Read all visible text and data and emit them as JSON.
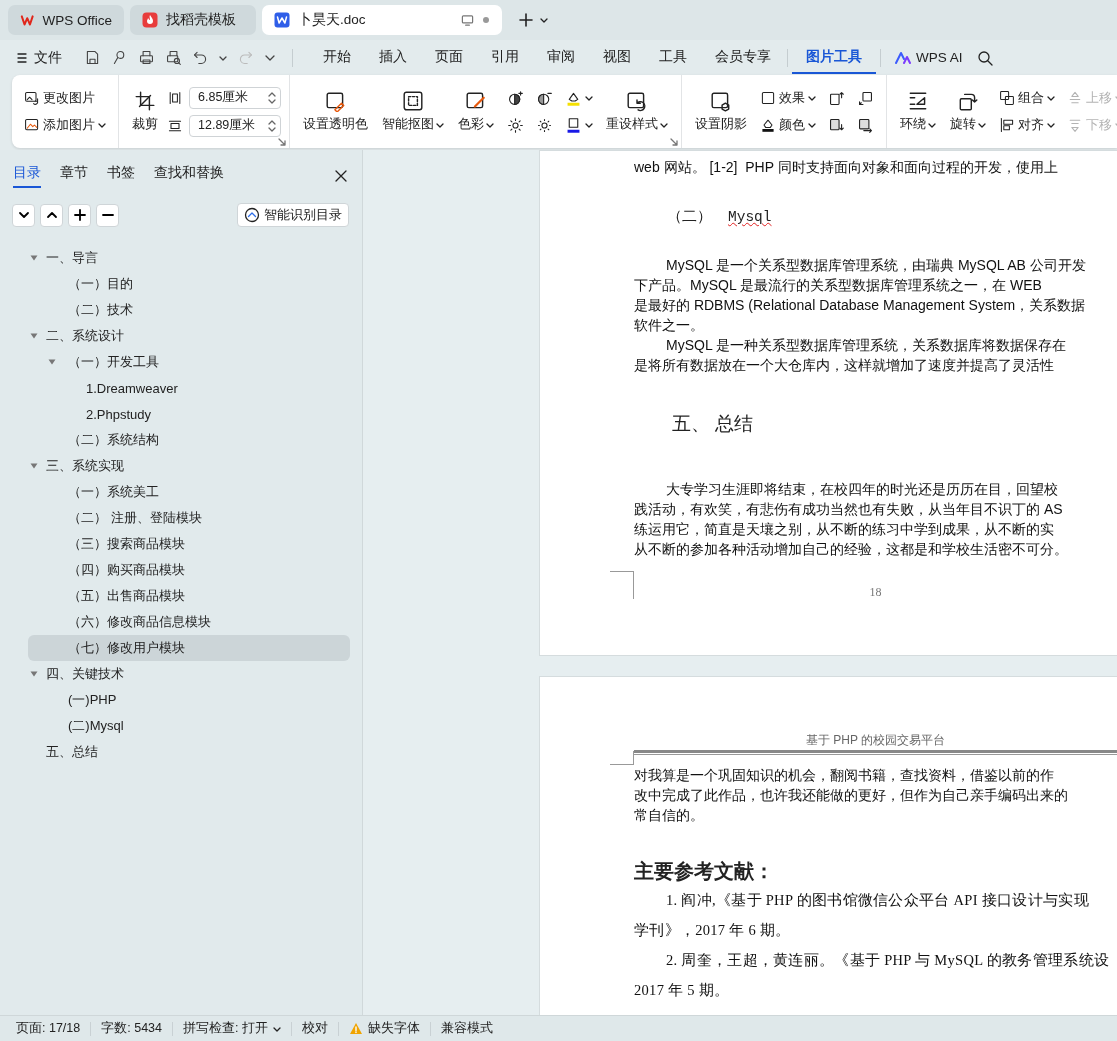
{
  "tabs": [
    {
      "label": "WPS Office",
      "kind": "home",
      "selected": false
    },
    {
      "label": "找稻壳模板",
      "kind": "template",
      "selected": false
    },
    {
      "label": "卜昊天.doc",
      "kind": "document",
      "selected": true
    }
  ],
  "menu": {
    "file": "文件",
    "items": [
      {
        "label": "开始",
        "kind": "tab",
        "selected": false
      },
      {
        "label": "插入",
        "kind": "tab",
        "selected": false
      },
      {
        "label": "页面",
        "kind": "tab",
        "selected": false
      },
      {
        "label": "引用",
        "kind": "tab",
        "selected": false
      },
      {
        "label": "审阅",
        "kind": "tab",
        "selected": false
      },
      {
        "label": "视图",
        "kind": "tab",
        "selected": false
      },
      {
        "label": "工具",
        "kind": "tab",
        "selected": false
      },
      {
        "label": "会员专享",
        "kind": "tab",
        "selected": false
      },
      {
        "label": "图片工具",
        "kind": "context",
        "selected": true
      }
    ],
    "ai": "WPS AI"
  },
  "ribbon": {
    "groups": [
      {
        "launcher": false,
        "columns": [
          [
            {
              "kind": "row",
              "label": "更改图片",
              "dropdown": false,
              "disabled": false
            },
            {
              "kind": "row",
              "label": "添加图片",
              "dropdown": true,
              "disabled": false
            }
          ]
        ]
      },
      {
        "launcher": true,
        "columns": [
          [
            {
              "kind": "big",
              "label": "裁剪",
              "dropdown": false,
              "disabled": false
            }
          ],
          [
            {
              "kind": "field",
              "value": "6.85厘米"
            },
            {
              "kind": "field",
              "value": "12.89厘米"
            }
          ]
        ]
      },
      {
        "launcher": true,
        "columns": [
          [
            {
              "kind": "big",
              "label": "设置透明色",
              "dropdown": false,
              "disabled": false
            }
          ],
          [
            {
              "kind": "big",
              "label": "智能抠图",
              "dropdown": true,
              "disabled": false
            }
          ],
          [
            {
              "kind": "big",
              "label": "色彩",
              "dropdown": true,
              "disabled": false
            }
          ],
          [
            {
              "kind": "icon",
              "dropdown": false,
              "disabled": false
            },
            {
              "kind": "icon",
              "dropdown": false,
              "disabled": false
            }
          ],
          [
            {
              "kind": "icon",
              "dropdown": false,
              "disabled": false
            },
            {
              "kind": "icon",
              "dropdown": false,
              "disabled": false
            }
          ],
          [
            {
              "kind": "icon",
              "dropdown": true,
              "disabled": false
            },
            {
              "kind": "icon",
              "dropdown": true,
              "disabled": false
            }
          ],
          [
            {
              "kind": "big",
              "label": "重设样式",
              "dropdown": true,
              "disabled": false
            }
          ]
        ]
      },
      {
        "launcher": false,
        "columns": [
          [
            {
              "kind": "big",
              "label": "设置阴影",
              "dropdown": false,
              "disabled": false
            }
          ],
          [
            {
              "kind": "row",
              "label": "效果",
              "dropdown": true,
              "disabled": false
            },
            {
              "kind": "row",
              "label": "颜色",
              "dropdown": true,
              "disabled": false
            }
          ],
          [
            {
              "kind": "icon",
              "dropdown": false,
              "disabled": false
            },
            {
              "kind": "icon",
              "dropdown": false,
              "disabled": false
            }
          ],
          [
            {
              "kind": "icon",
              "dropdown": false,
              "disabled": false
            },
            {
              "kind": "icon",
              "dropdown": false,
              "disabled": false
            }
          ]
        ]
      },
      {
        "launcher": false,
        "columns": [
          [
            {
              "kind": "big",
              "label": "环绕",
              "dropdown": true,
              "disabled": false
            }
          ],
          [
            {
              "kind": "big",
              "label": "旋转",
              "dropdown": true,
              "disabled": false
            }
          ],
          [
            {
              "kind": "row",
              "label": "组合",
              "dropdown": true,
              "disabled": false
            },
            {
              "kind": "row",
              "label": "对齐",
              "dropdown": true,
              "disabled": false
            }
          ],
          [
            {
              "kind": "row",
              "label": "上移",
              "dropdown": true,
              "disabled": true
            },
            {
              "kind": "row",
              "label": "下移",
              "dropdown": true,
              "disabled": true
            }
          ]
        ]
      }
    ]
  },
  "nav": {
    "tabs": [
      {
        "label": "目录",
        "selected": true
      },
      {
        "label": "章节",
        "selected": false
      },
      {
        "label": "书签",
        "selected": false
      },
      {
        "label": "查找和替换",
        "selected": false
      }
    ],
    "smart_button": "智能识别目录",
    "tree": [
      {
        "label": "一、导言",
        "expanded": true,
        "selected": false,
        "children": [
          {
            "label": "（一）目的",
            "selected": false
          },
          {
            "label": "（二）技术",
            "selected": false
          }
        ]
      },
      {
        "label": "二、系统设计",
        "expanded": true,
        "selected": false,
        "children": [
          {
            "label": "（一）开发工具",
            "expanded": true,
            "selected": false,
            "children": [
              {
                "label": "1.Dreamweaver",
                "selected": false
              },
              {
                "label": "2.Phpstudy",
                "selected": false
              }
            ]
          },
          {
            "label": "（二）系统结构",
            "selected": false
          }
        ]
      },
      {
        "label": "三、系统实现",
        "expanded": true,
        "selected": false,
        "children": [
          {
            "label": "（一）系统美工",
            "selected": false
          },
          {
            "label": "（二） 注册、登陆模块",
            "selected": false
          },
          {
            "label": "（三）搜索商品模块",
            "selected": false
          },
          {
            "label": "（四）购买商品模块",
            "selected": false
          },
          {
            "label": "（五）出售商品模块",
            "selected": false
          },
          {
            "label": "（六）修改商品信息模块",
            "selected": false
          },
          {
            "label": "（七）修改用户模块",
            "selected": true
          }
        ]
      },
      {
        "label": "四、关键技术",
        "expanded": true,
        "selected": false,
        "children": [
          {
            "label": "(一)PHP",
            "selected": false
          },
          {
            "label": "(二)Mysql",
            "selected": false
          }
        ]
      },
      {
        "label": "五、总结",
        "selected": false
      }
    ]
  },
  "doc": {
    "pages": [
      {
        "blocks": [
          {
            "kind": "para",
            "continued": true,
            "lines": [
              "web 网站。 [1-2]  PHP 同时支持面向对象和面向过程的开发，使用上"
            ]
          },
          {
            "kind": "subheading",
            "number": "（二）",
            "text": "Mysql",
            "misspelled": true
          },
          {
            "kind": "para",
            "continued": false,
            "lines": [
              "MySQL 是一个关系型数据库管理系统，由瑞典 MySQL AB 公司开发",
              "下产品。MySQL 是最流行的关系型数据库管理系统之一，在 WEB",
              "是最好的 RDBMS (Relational Database Management System，关系数据",
              "软件之一。"
            ]
          },
          {
            "kind": "para",
            "continued": false,
            "lines": [
              "MySQL 是一种关系型数据库管理系统，关系数据库将数据保存在",
              "是将所有数据放在一个大仓库内，这样就增加了速度并提高了灵活性"
            ]
          },
          {
            "kind": "heading",
            "text": "五、 总结"
          },
          {
            "kind": "para",
            "continued": false,
            "lines": [
              "大专学习生涯即将结束，在校四年的时光还是历历在目，回望校",
              "践活动，有欢笑，有悲伤有成功当然也有失败，从当年目不识丁的 AS",
              "练运用它，简直是天壤之别，从不断的练习中学到成果，从不断的实",
              "从不断的参加各种活动增加自己的经验，这都是和学校生活密不可分。"
            ]
          },
          {
            "kind": "pagenum",
            "text": "18"
          }
        ]
      },
      {
        "blocks": [
          {
            "kind": "header",
            "text": "基于 PHP 的校园交易平台"
          },
          {
            "kind": "para",
            "continued": true,
            "lines": [
              "对我算是一个巩固知识的机会，翻阅书籍，查找资料，借鉴以前的作",
              "改中完成了此作品，也许我还能做的更好，但作为自己亲手编码出来的",
              "常自信的。"
            ]
          },
          {
            "kind": "title",
            "text": "主要参考文献："
          },
          {
            "kind": "reference",
            "lines": [
              "1. 阎冲,《基于 PHP 的图书馆微信公众平台 API 接口设计与实现",
              "学刊》，2017 年 6 期。"
            ]
          },
          {
            "kind": "reference",
            "lines": [
              "2. 周奎，王超，黄连丽。《基于 PHP 与 MySQL 的教务管理系统设",
              "2017 年 5 期。"
            ]
          }
        ]
      }
    ]
  },
  "status": {
    "items": [
      {
        "kind": "text",
        "label": "页面: 17/18"
      },
      {
        "kind": "text",
        "label": "字数: 5434"
      },
      {
        "kind": "dropdown",
        "label": "拼写检查: 打开"
      },
      {
        "kind": "text",
        "label": "校对"
      },
      {
        "kind": "warning",
        "label": "缺失字体"
      },
      {
        "kind": "text",
        "label": "兼容模式"
      }
    ]
  }
}
